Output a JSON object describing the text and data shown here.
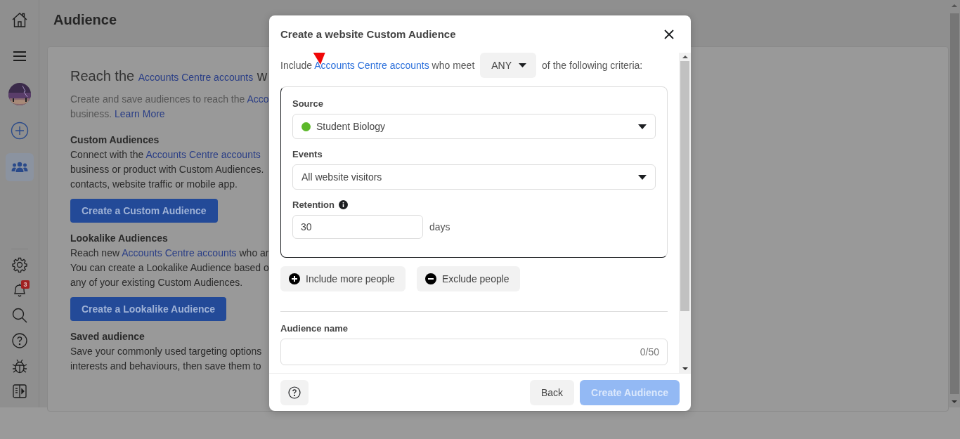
{
  "nav_items": [
    {
      "kind": "home",
      "selected": false
    },
    {
      "kind": "menu",
      "selected": false
    },
    {
      "kind": "avatar",
      "selected": false
    },
    {
      "kind": "add",
      "selected": false
    },
    {
      "kind": "audiences",
      "selected": true
    }
  ],
  "nav_bottom": [
    {
      "kind": "settings",
      "selected": false
    },
    {
      "kind": "notifications",
      "selected": false,
      "badge": "3"
    },
    {
      "kind": "search",
      "selected": false
    },
    {
      "kind": "help",
      "selected": false
    },
    {
      "kind": "bug",
      "selected": false
    },
    {
      "kind": "panel",
      "selected": false
    }
  ],
  "page": {
    "title": "Audience"
  },
  "card": {
    "heading": [
      {
        "text": "Reach the ",
        "kind": "text"
      },
      {
        "text": "Accounts Centre accounts",
        "kind": "link"
      },
      {
        "text": " w",
        "kind": "text"
      }
    ],
    "intro": [
      [
        {
          "text": "Create and save audiences to reach the ",
          "kind": "text"
        },
        {
          "text": "Acco",
          "kind": "link"
        }
      ],
      [
        {
          "text": "business. ",
          "kind": "text"
        },
        {
          "text": "Learn More",
          "kind": "link"
        }
      ]
    ],
    "sections": [
      {
        "title": "Custom Audiences",
        "lines": [
          [
            {
              "text": "Connect with the ",
              "kind": "text"
            },
            {
              "text": "Accounts Centre accounts",
              "kind": "link"
            }
          ],
          [
            {
              "text": "business or product with Custom Audiences.",
              "kind": "text"
            }
          ],
          [
            {
              "text": "contacts, website traffic or mobile app.",
              "kind": "text"
            }
          ]
        ],
        "button": "Create a Custom Audience"
      },
      {
        "title": "Lookalike Audiences",
        "lines": [
          [
            {
              "text": "Reach new ",
              "kind": "text"
            },
            {
              "text": "Accounts Centre accounts",
              "kind": "link"
            },
            {
              "text": " who ar",
              "kind": "text"
            }
          ],
          [
            {
              "text": "You can create a Lookalike Audience based o",
              "kind": "text"
            }
          ],
          [
            {
              "text": "any of your existing Custom Audiences.",
              "kind": "text"
            }
          ]
        ],
        "button": "Create a Lookalike Audience"
      },
      {
        "title": "Saved audience",
        "lines": [
          [
            {
              "text": "Save your commonly used targeting options",
              "kind": "text"
            }
          ],
          [
            {
              "text": "interests and behaviours, then save them to",
              "kind": "text"
            }
          ]
        ]
      }
    ]
  },
  "dialog": {
    "title": "Create a website Custom Audience",
    "criteria": {
      "prefix": "Include",
      "link": "Accounts Centre accounts",
      "middle": "who meet",
      "match": "ANY",
      "suffix": "of the following criteria:"
    },
    "rule": {
      "source_label": "Source",
      "source": {
        "value": "Student Biology",
        "color": "#5cb82a"
      },
      "events_label": "Events",
      "events": "All website visitors",
      "retention_label": "Retention",
      "retention": "30",
      "retention_unit": "days"
    },
    "actions": [
      {
        "kind": "include",
        "label": "Include more people"
      },
      {
        "kind": "exclude",
        "label": "Exclude people"
      }
    ],
    "name_label": "Audience name",
    "name_counter": "0/50",
    "footer": {
      "back": "Back",
      "create": "Create Audience",
      "create_disabled": true
    }
  }
}
